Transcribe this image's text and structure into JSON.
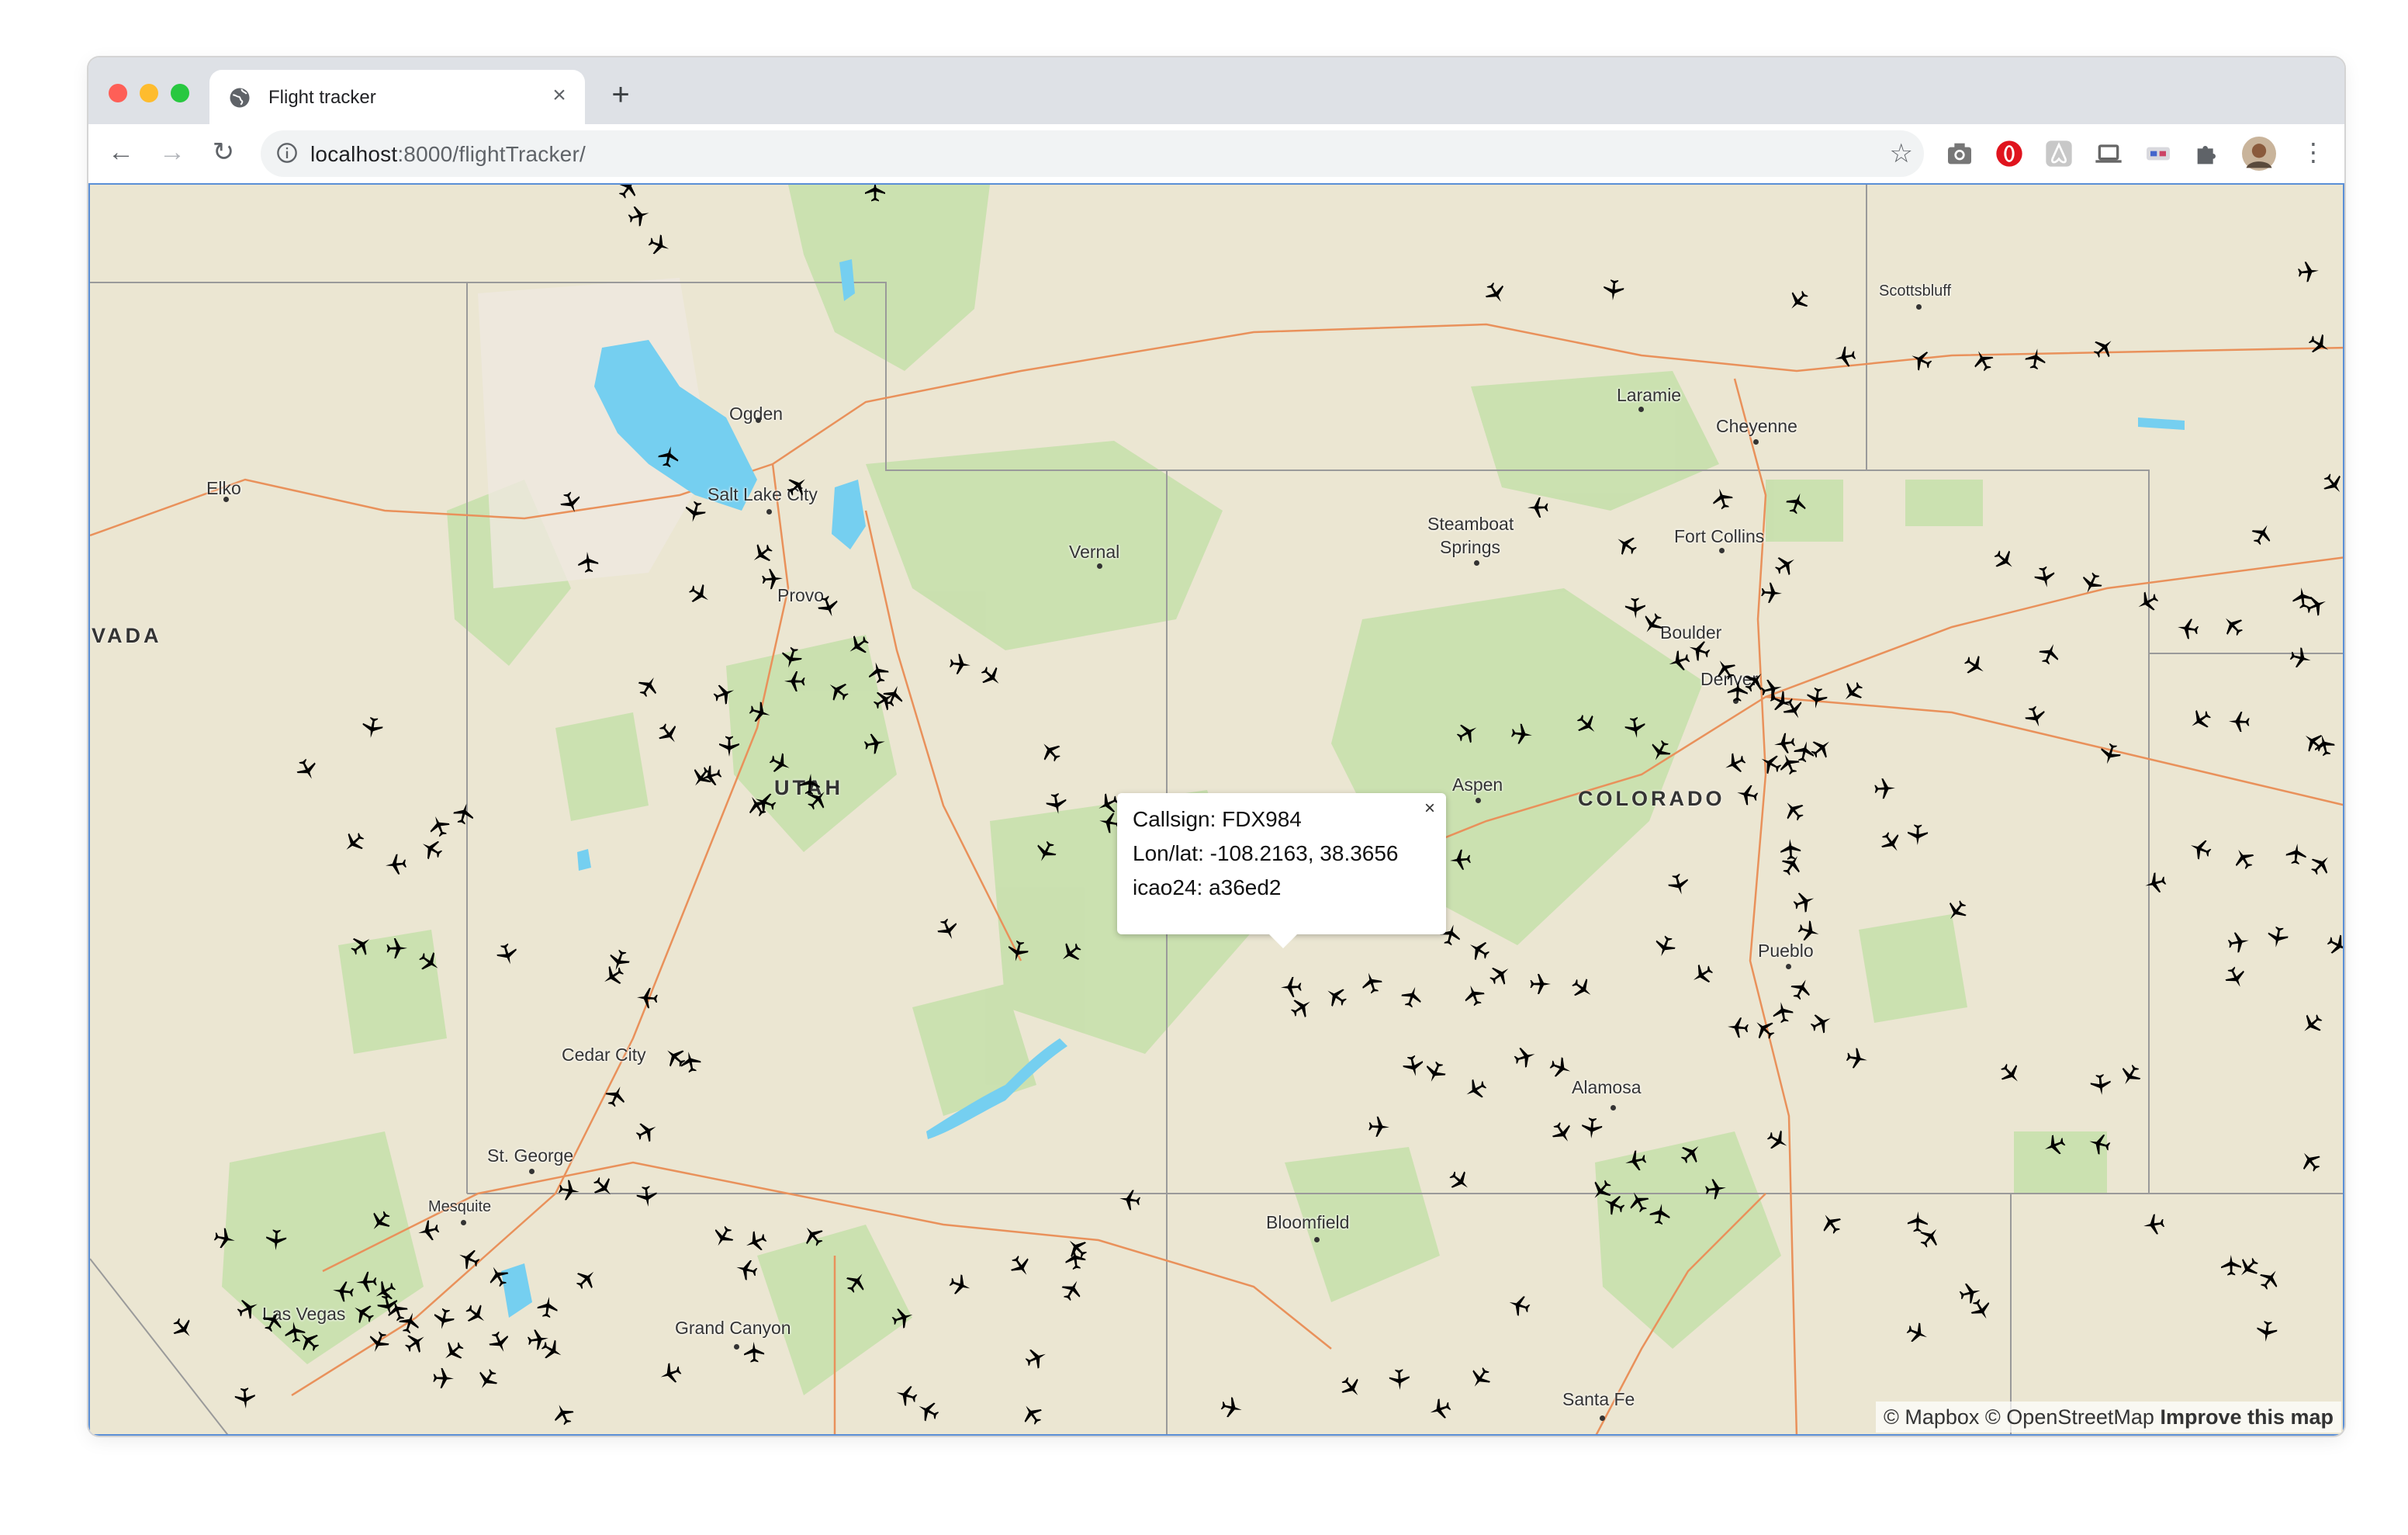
{
  "browser": {
    "tab_title": "Flight tracker",
    "tab_close": "×",
    "new_tab": "+",
    "url_host": "localhost",
    "url_rest": ":8000/flightTracker/"
  },
  "map": {
    "states": [
      "VADA",
      "UTAH",
      "COLORADO"
    ],
    "cities": [
      "Elko",
      "Ogden",
      "Salt Lake City",
      "Provo",
      "Vernal",
      "Steamboat",
      "Springs",
      "Laramie",
      "Cheyenne",
      "Scottsbluff",
      "Fort Collins",
      "Boulder",
      "Denver",
      "Aspen",
      "Pueblo",
      "Alamosa",
      "Cedar City",
      "St. George",
      "Mesquite",
      "Las Vegas",
      "Grand Canyon",
      "Bloomfield",
      "Santa Fe"
    ],
    "popup": {
      "close": "×",
      "callsign": "Callsign: FDX984",
      "lonlat": "Lon/lat: -108.2163, 38.3656",
      "icao": "icao24: a36ed2"
    },
    "attribution": {
      "mapbox": "© Mapbox",
      "osm": "© OpenStreetMap",
      "improve": "Improve this map"
    }
  },
  "colors": {
    "map_background": "#ebe6d2",
    "park_green": "#c5dfaa",
    "water": "#75cff0",
    "highway": "#e9915b",
    "state_border": "#9a9a9a",
    "aircraft": "#000000"
  },
  "icons": [
    "globe-icon",
    "info-icon",
    "back-icon",
    "forward-icon",
    "reload-icon",
    "star-icon",
    "camera-icon",
    "opera-icon",
    "airbnb-icon",
    "laptop-icon",
    "extension-icon",
    "puzzle-icon",
    "avatar",
    "menu-icon",
    "airplane-icon"
  ]
}
